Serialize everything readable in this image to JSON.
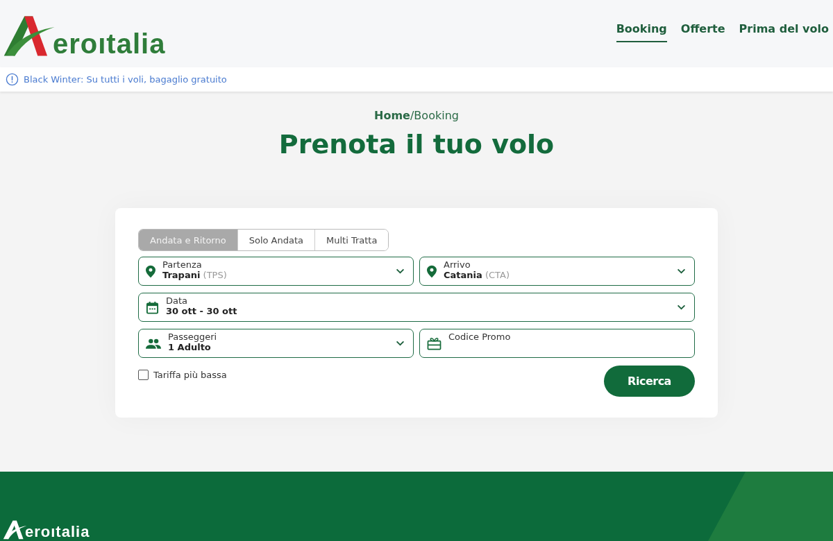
{
  "header": {
    "logo_text": "eroıtalia",
    "nav": [
      {
        "label": "Booking",
        "selected": true
      },
      {
        "label": "Offerte",
        "selected": false
      },
      {
        "label": "Prima del volo",
        "selected": false
      }
    ]
  },
  "banner": {
    "text": "Black Winter: Su tutti i voli, bagaglio gratuito"
  },
  "breadcrumb": "**Home**/Booking",
  "title": "Prenota il tuo volo",
  "booking_form": {
    "trip_types": [
      {
        "label": "Andata e Ritorno",
        "selected": true
      },
      {
        "label": "Solo Andata",
        "selected": false
      },
      {
        "label": "Multi Tratta",
        "selected": false
      }
    ],
    "fields": [
      {
        "kind": "location",
        "label": "Partenza",
        "value": "Trapani",
        "code": "(TPS)"
      },
      {
        "kind": "location",
        "label": "Arrivo",
        "value": "Catania",
        "code": "(CTA)"
      },
      {
        "kind": "date",
        "label": "Data",
        "value": "30 ott - 30 ott"
      },
      {
        "kind": "passengers",
        "label": "Passeggeri",
        "value": "1 Adulto"
      },
      {
        "kind": "promo",
        "label": "Codice Promo"
      }
    ],
    "lowest_fare": {
      "label": "Tariffa più bassa",
      "checked": false
    },
    "search_button": "Ricerca"
  },
  "footer": {
    "logo_text": "eroıtalia"
  }
}
